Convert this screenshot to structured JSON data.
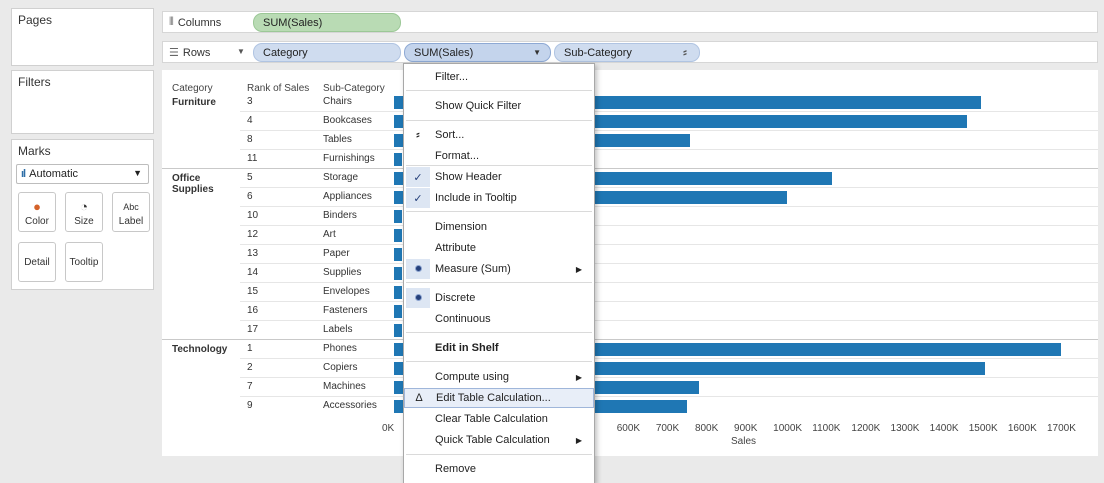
{
  "panels": {
    "pages": "Pages",
    "filters": "Filters",
    "marks": "Marks",
    "marks_type": "Automatic",
    "mark_buttons": [
      "Color",
      "Size",
      "Label",
      "Detail",
      "Tooltip"
    ]
  },
  "shelves": {
    "columns_label": "Columns",
    "rows_label": "Rows",
    "columns_pill": "SUM(Sales)",
    "rows_pills": [
      "Category",
      "SUM(Sales)",
      "Sub-Category"
    ]
  },
  "table": {
    "headers": [
      "Category",
      "Rank of Sales",
      "Sub-Category"
    ],
    "groups": [
      "Furniture",
      "Office Supplies",
      "Technology"
    ],
    "rows": [
      {
        "rank": "3",
        "sub": "Chairs",
        "sales": 1500000
      },
      {
        "rank": "4",
        "sub": "Bookcases",
        "sales": 1465000
      },
      {
        "rank": "8",
        "sub": "Tables",
        "sales": 757000
      },
      {
        "rank": "11",
        "sub": "Furnishings",
        "sales": 0
      },
      {
        "rank": "5",
        "sub": "Storage",
        "sales": 1120000
      },
      {
        "rank": "6",
        "sub": "Appliances",
        "sales": 1005000
      },
      {
        "rank": "10",
        "sub": "Binders",
        "sales": 0
      },
      {
        "rank": "12",
        "sub": "Art",
        "sales": 0
      },
      {
        "rank": "13",
        "sub": "Paper",
        "sales": 0
      },
      {
        "rank": "14",
        "sub": "Supplies",
        "sales": 0
      },
      {
        "rank": "15",
        "sub": "Envelopes",
        "sales": 0
      },
      {
        "rank": "16",
        "sub": "Fasteners",
        "sales": 0
      },
      {
        "rank": "17",
        "sub": "Labels",
        "sales": 0
      },
      {
        "rank": "1",
        "sub": "Phones",
        "sales": 1705000
      },
      {
        "rank": "2",
        "sub": "Copiers",
        "sales": 1510000
      },
      {
        "rank": "7",
        "sub": "Machines",
        "sales": 780000
      },
      {
        "rank": "9",
        "sub": "Accessories",
        "sales": 750000
      }
    ]
  },
  "chart_data": {
    "type": "bar",
    "categories": [
      "Chairs",
      "Bookcases",
      "Tables",
      "Furnishings",
      "Storage",
      "Appliances",
      "Binders",
      "Art",
      "Paper",
      "Supplies",
      "Envelopes",
      "Fasteners",
      "Labels",
      "Phones",
      "Copiers",
      "Machines",
      "Accessories"
    ],
    "values": [
      1500000,
      1465000,
      757000,
      0,
      1120000,
      1005000,
      0,
      0,
      0,
      0,
      0,
      0,
      0,
      1705000,
      1510000,
      780000,
      750000
    ],
    "xlabel": "Sales",
    "ylabel": "",
    "xlim": [
      0,
      1750000
    ],
    "orientation": "horizontal",
    "bar_color": "#1f77b4",
    "ticks": [
      {
        "value": 0,
        "label": "0K"
      },
      {
        "value": 600000,
        "label": "600K"
      },
      {
        "value": 700000,
        "label": "700K"
      },
      {
        "value": 800000,
        "label": "800K"
      },
      {
        "value": 900000,
        "label": "900K"
      },
      {
        "value": 1000000,
        "label": "1000K"
      },
      {
        "value": 1100000,
        "label": "1100K"
      },
      {
        "value": 1200000,
        "label": "1200K"
      },
      {
        "value": 1300000,
        "label": "1300K"
      },
      {
        "value": 1400000,
        "label": "1400K"
      },
      {
        "value": 1500000,
        "label": "1500K"
      },
      {
        "value": 1600000,
        "label": "1600K"
      },
      {
        "value": 1700000,
        "label": "1700K"
      }
    ]
  },
  "menu": {
    "items": [
      "Filter...",
      "Show Quick Filter",
      "Sort...",
      "Format...",
      "Show Header",
      "Include in Tooltip",
      "Dimension",
      "Attribute",
      "Measure (Sum)",
      "Discrete",
      "Continuous",
      "Edit in Shelf",
      "Compute using",
      "Edit Table Calculation...",
      "Clear Table Calculation",
      "Quick Table Calculation",
      "Remove"
    ],
    "icons": {
      "check": "✓",
      "delta": "Δ"
    }
  }
}
